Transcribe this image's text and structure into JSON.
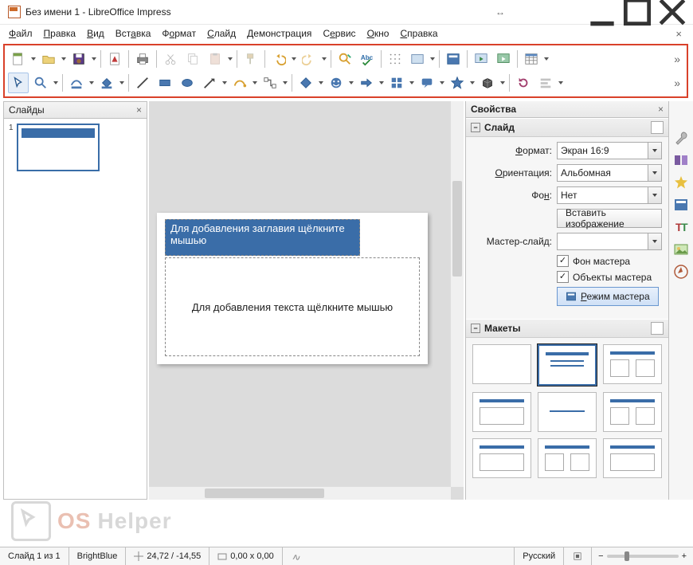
{
  "window": {
    "title": "Без имени 1 - LibreOffice Impress"
  },
  "menu": {
    "items": [
      "Файл",
      "Правка",
      "Вид",
      "Вставка",
      "Формат",
      "Слайд",
      "Демонстрация",
      "Сервис",
      "Окно",
      "Справка"
    ]
  },
  "panes": {
    "slides": {
      "title": "Слайды",
      "slide_number": "1"
    },
    "properties": {
      "title": "Свойства"
    }
  },
  "slide": {
    "title_placeholder": "Для добавления заглавия щёлкните мышью",
    "body_placeholder": "Для добавления текста щёлкните мышью"
  },
  "props_slide": {
    "section": "Слайд",
    "format_label": "Формат:",
    "format_value": "Экран 16:9",
    "orientation_label": "Ориентация:",
    "orientation_value": "Альбомная",
    "background_label": "Фон:",
    "background_value": "Нет",
    "insert_image_btn": "Вставить изображение",
    "master_slide_label": "Мастер-слайд:",
    "master_bg_chk": "Фон мастера",
    "master_obj_chk": "Объекты мастера",
    "master_mode_btn": "Режим мастера"
  },
  "props_layouts": {
    "section": "Макеты"
  },
  "status": {
    "slide_of": "Слайд 1 из 1",
    "theme": "BrightBlue",
    "pos": "24,72 / -14,55",
    "size": "0,00 x 0,00",
    "lang": "Русский"
  },
  "watermark": {
    "os": "OS",
    "helper": "Helper"
  }
}
